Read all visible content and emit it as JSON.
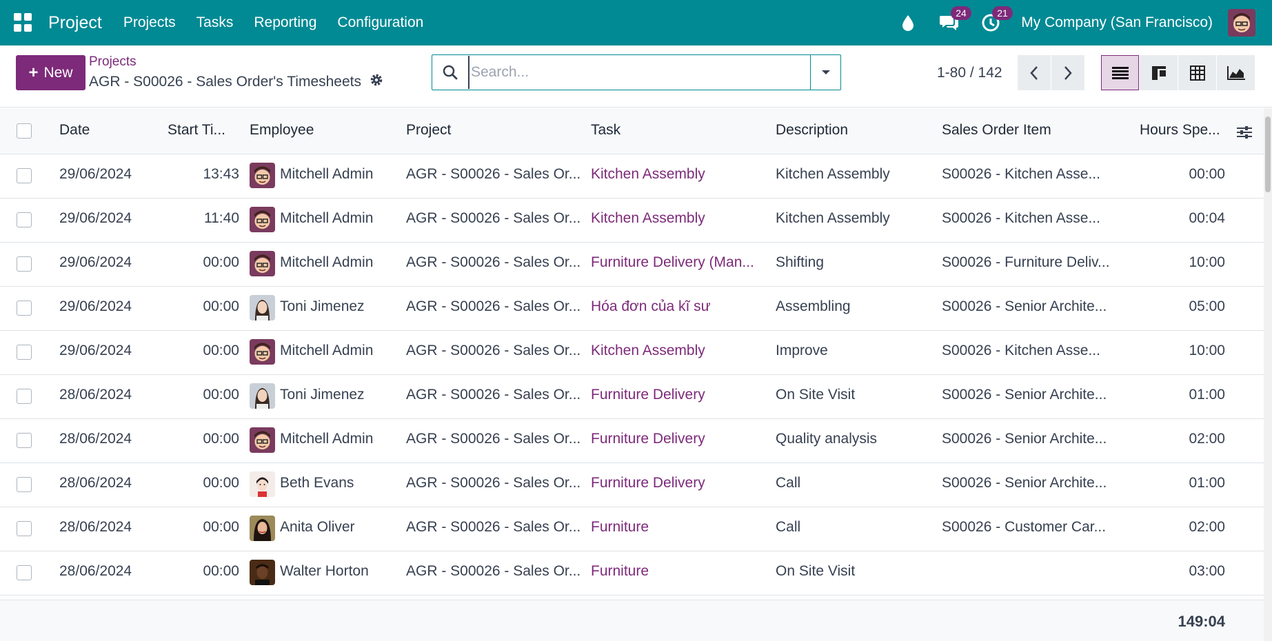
{
  "navbar": {
    "brand": "Project",
    "menu": [
      "Projects",
      "Tasks",
      "Reporting",
      "Configuration"
    ],
    "messages_count": "24",
    "activities_count": "21",
    "company": "My Company (San Francisco)"
  },
  "control": {
    "new_label": "New",
    "breadcrumb_parent": "Projects",
    "breadcrumb_current": "AGR - S00026 - Sales Order's Timesheets",
    "search_placeholder": "Search...",
    "pager": "1-80 / 142"
  },
  "table": {
    "headers": [
      "Date",
      "Start Ti...",
      "Employee",
      "Project",
      "Task",
      "Description",
      "Sales Order Item",
      "Hours Spe..."
    ],
    "rows": [
      {
        "date": "29/06/2024",
        "start": "13:43",
        "employee": "Mitchell Admin",
        "avatar": "mitchell",
        "project": "AGR - S00026 - Sales Or...",
        "task": "Kitchen Assembly",
        "description": "Kitchen Assembly",
        "so_item": "S00026 - Kitchen Asse...",
        "hours": "00:00"
      },
      {
        "date": "29/06/2024",
        "start": "11:40",
        "employee": "Mitchell Admin",
        "avatar": "mitchell",
        "project": "AGR - S00026 - Sales Or...",
        "task": "Kitchen Assembly",
        "description": "Kitchen Assembly",
        "so_item": "S00026 - Kitchen Asse...",
        "hours": "00:04"
      },
      {
        "date": "29/06/2024",
        "start": "00:00",
        "employee": "Mitchell Admin",
        "avatar": "mitchell",
        "project": "AGR - S00026 - Sales Or...",
        "task": "Furniture Delivery (Man...",
        "description": "Shifting",
        "so_item": "S00026 - Furniture Deliv...",
        "hours": "10:00"
      },
      {
        "date": "29/06/2024",
        "start": "00:00",
        "employee": "Toni Jimenez",
        "avatar": "toni",
        "project": "AGR - S00026 - Sales Or...",
        "task": "Hóa đơn của kĩ sư",
        "description": "Assembling",
        "so_item": "S00026 - Senior Archite...",
        "hours": "05:00"
      },
      {
        "date": "29/06/2024",
        "start": "00:00",
        "employee": "Mitchell Admin",
        "avatar": "mitchell",
        "project": "AGR - S00026 - Sales Or...",
        "task": "Kitchen Assembly",
        "description": "Improve",
        "so_item": "S00026 - Kitchen Asse...",
        "hours": "10:00"
      },
      {
        "date": "28/06/2024",
        "start": "00:00",
        "employee": "Toni Jimenez",
        "avatar": "toni",
        "project": "AGR - S00026 - Sales Or...",
        "task": "Furniture Delivery",
        "description": "On Site Visit",
        "so_item": "S00026 - Senior Archite...",
        "hours": "01:00"
      },
      {
        "date": "28/06/2024",
        "start": "00:00",
        "employee": "Mitchell Admin",
        "avatar": "mitchell",
        "project": "AGR - S00026 - Sales Or...",
        "task": "Furniture Delivery",
        "description": "Quality analysis",
        "so_item": "S00026 - Senior Archite...",
        "hours": "02:00"
      },
      {
        "date": "28/06/2024",
        "start": "00:00",
        "employee": "Beth Evans",
        "avatar": "beth",
        "project": "AGR - S00026 - Sales Or...",
        "task": "Furniture Delivery",
        "description": "Call",
        "so_item": "S00026 - Senior Archite...",
        "hours": "01:00"
      },
      {
        "date": "28/06/2024",
        "start": "00:00",
        "employee": "Anita Oliver",
        "avatar": "anita",
        "project": "AGR - S00026 - Sales Or...",
        "task": "Furniture",
        "description": "Call",
        "so_item": "S00026 - Customer Car...",
        "hours": "02:00"
      },
      {
        "date": "28/06/2024",
        "start": "00:00",
        "employee": "Walter Horton",
        "avatar": "walter",
        "project": "AGR - S00026 - Sales Or...",
        "task": "Furniture",
        "description": "On Site Visit",
        "so_item": "",
        "hours": "03:00"
      }
    ],
    "total": "149:04"
  }
}
